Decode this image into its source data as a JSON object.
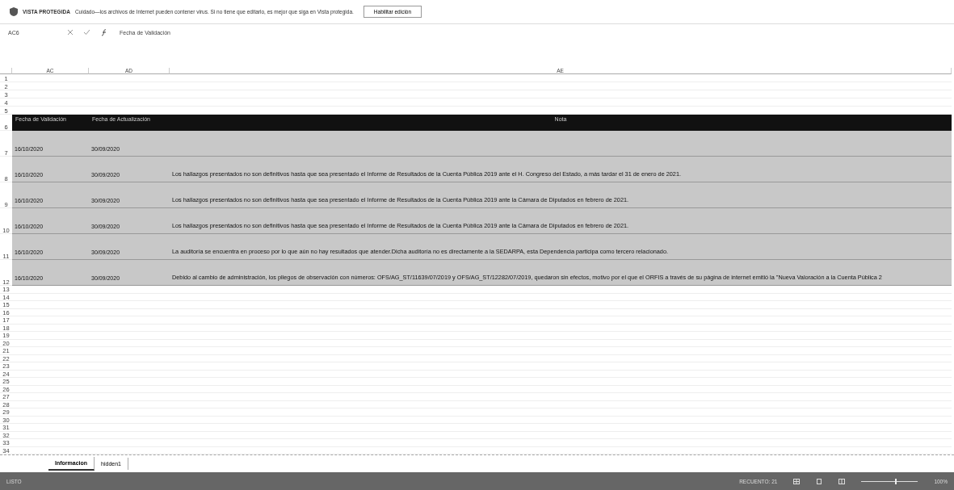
{
  "protected_view": {
    "label": "VISTA PROTEGIDA",
    "message": "Cuidado—los archivos de Internet pueden contener virus. Si no tiene que editarlo, es mejor que siga en Vista protegida.",
    "button": "Habilitar edición"
  },
  "formula_bar": {
    "name_box": "AC6",
    "formula": "Fecha de Validación"
  },
  "columns": [
    "AC",
    "AD",
    "AE"
  ],
  "top_rows": [
    "1",
    "2",
    "3",
    "4",
    "5"
  ],
  "header_row": {
    "number": "6",
    "cells": [
      "Fecha de Validación",
      "Fecha de Actualización",
      "Nota"
    ]
  },
  "rows": [
    {
      "number": "7",
      "validation": "16/10/2020",
      "update": "30/09/2020",
      "note": ""
    },
    {
      "number": "8",
      "validation": "16/10/2020",
      "update": "30/09/2020",
      "note": "Los hallazgos presentados no son definitivos hasta que sea presentado el Informe de Resultados de la Cuenta Pública 2019 ante el H. Congreso del Estado, a más tardar el 31 de enero de 2021."
    },
    {
      "number": "9",
      "validation": "16/10/2020",
      "update": "30/09/2020",
      "note": "Los hallazgos presentados no son definitivos hasta que sea presentado el Informe de Resultados de la Cuenta Pública 2019 ante la Cámara de Diputados en febrero de 2021."
    },
    {
      "number": "10",
      "validation": "16/10/2020",
      "update": "30/09/2020",
      "note": "Los hallazgos presentados no son definitivos hasta que sea presentado el Informe de Resultados de la Cuenta Pública 2019 ante la Cámara de Diputados en febrero de 2021."
    },
    {
      "number": "11",
      "validation": "16/10/2020",
      "update": "30/09/2020",
      "note": "La auditoría se encuentra en proceso por lo que aún no hay resultados que atender.Dicha auditoría no es directamente a la SEDARPA, esta Dependencia participa como tercero relacionado."
    },
    {
      "number": "12",
      "validation": "16/10/2020",
      "update": "30/09/2020",
      "note": "Debido al cambio de administración, los pliegos de observación con números: OFS/AG_ST/11639/07/2019 y OFS/AG_ST/12282/07/2019, quedaron sin efectos, motivo por el que el ORFIS a través de su página de internet emitió la \"Nueva Valoración a la Cuenta Pública 2"
    }
  ],
  "empty_rows": [
    "13",
    "14",
    "15",
    "16",
    "17",
    "18",
    "19",
    "20",
    "21",
    "22",
    "23",
    "24",
    "25",
    "26",
    "27",
    "28",
    "29",
    "30",
    "31",
    "32",
    "33",
    "34"
  ],
  "sheet_tabs": [
    {
      "label": "Informacion",
      "selected": true
    },
    {
      "label": "hidden1",
      "selected": false
    }
  ],
  "status_bar": {
    "mode": "LISTO",
    "count": "RECUENTO: 21",
    "zoom": "100%",
    "zoom_slider": {
      "level": 0.6
    }
  }
}
